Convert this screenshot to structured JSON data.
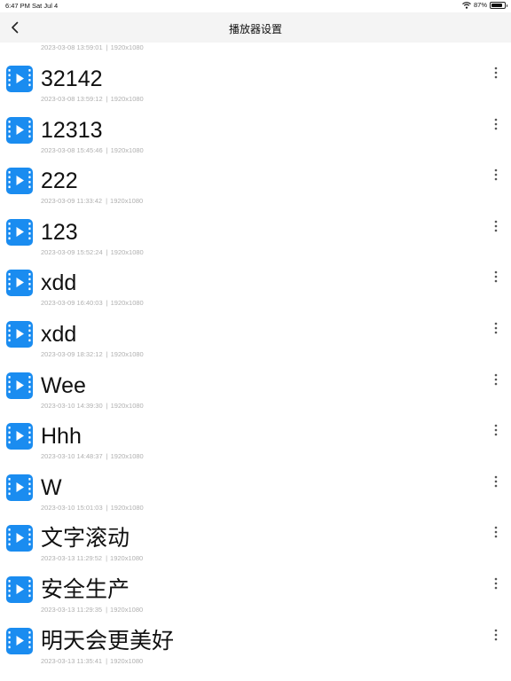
{
  "status_bar": {
    "time": "6:47 PM",
    "date": "Sat Jul 4",
    "battery_text": "87%",
    "battery_level": 0.87
  },
  "nav": {
    "title": "播放器设置",
    "back_icon": "chevron-left-icon"
  },
  "partial_item": {
    "date": "2023-03-08 13:59:01",
    "resolution": "1920x1080"
  },
  "items": [
    {
      "title": "32142",
      "date": "2023-03-08 13:59:12",
      "resolution": "1920x1080"
    },
    {
      "title": "12313",
      "date": "2023-03-08 15:45:46",
      "resolution": "1920x1080"
    },
    {
      "title": "222",
      "date": "2023-03-09 11:33:42",
      "resolution": "1920x1080"
    },
    {
      "title": "123",
      "date": "2023-03-09 15:52:24",
      "resolution": "1920x1080"
    },
    {
      "title": "xdd",
      "date": "2023-03-09 16:40:03",
      "resolution": "1920x1080"
    },
    {
      "title": "xdd",
      "date": "2023-03-09 18:32:12",
      "resolution": "1920x1080"
    },
    {
      "title": "Wee",
      "date": "2023-03-10 14:39:30",
      "resolution": "1920x1080"
    },
    {
      "title": "Hhh",
      "date": "2023-03-10 14:48:37",
      "resolution": "1920x1080"
    },
    {
      "title": "W",
      "date": "2023-03-10 15:01:03",
      "resolution": "1920x1080"
    },
    {
      "title": "文字滚动",
      "date": "2023-03-13 11:29:52",
      "resolution": "1920x1080"
    },
    {
      "title": "安全生产",
      "date": "2023-03-13 11:29:35",
      "resolution": "1920x1080"
    },
    {
      "title": "明天会更美好",
      "date": "2023-03-13 11:35:41",
      "resolution": "1920x1080"
    }
  ],
  "meta_separator": "|",
  "colors": {
    "accent": "#1a8cf0",
    "meta_text": "#b0b0b0",
    "nav_bg": "#f4f4f4"
  }
}
